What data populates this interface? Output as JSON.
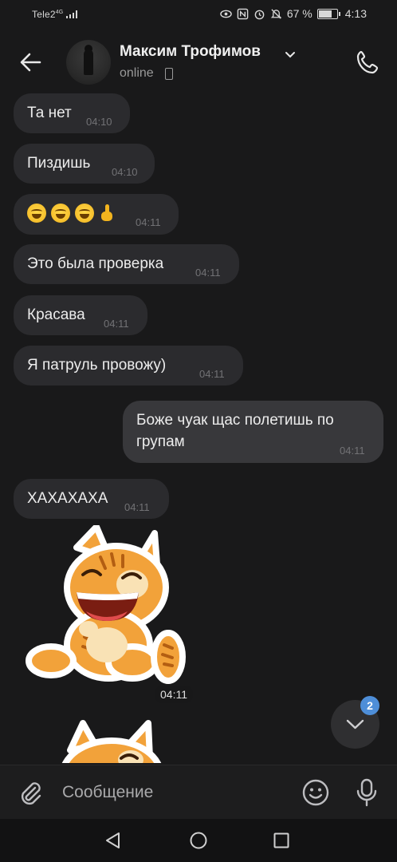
{
  "status_bar": {
    "carrier": "Tele2",
    "network": "4G",
    "battery": "67 %",
    "time": "4:13"
  },
  "header": {
    "contact_name": "Максим Трофимов",
    "status": "online",
    "icons": [
      "back-arrow-icon",
      "chevron-down-icon",
      "mobile-device-icon",
      "phone-icon"
    ]
  },
  "messages": [
    {
      "direction": "incoming",
      "text": "Та нет",
      "time": "04:10"
    },
    {
      "direction": "incoming",
      "text": "Пиздишь",
      "time": "04:10"
    },
    {
      "direction": "incoming",
      "text": "😆😆😆☝️",
      "time": "04:11"
    },
    {
      "direction": "incoming",
      "text": "Это была проверка",
      "time": "04:11"
    },
    {
      "direction": "incoming",
      "text": "Красава",
      "time": "04:11"
    },
    {
      "direction": "incoming",
      "text": "Я патруль провожу)",
      "time": "04:11"
    },
    {
      "direction": "outgoing",
      "text": "Боже чуак щас полетишь по групам",
      "time": "04:11"
    },
    {
      "direction": "incoming",
      "text": "ХАХАХАХА",
      "time": "04:11"
    },
    {
      "direction": "incoming",
      "type": "sticker",
      "sticker": "laughing-cat-sticker",
      "time": "04:11"
    }
  ],
  "scroll_down": {
    "unread_count": "2"
  },
  "composer": {
    "placeholder": "Сообщение"
  },
  "colors": {
    "background": "#19191a",
    "incoming_bubble": "#2b2b2e",
    "outgoing_bubble": "#38383b",
    "badge": "#4e8ed8",
    "sticker_orange": "#f2a23a"
  }
}
